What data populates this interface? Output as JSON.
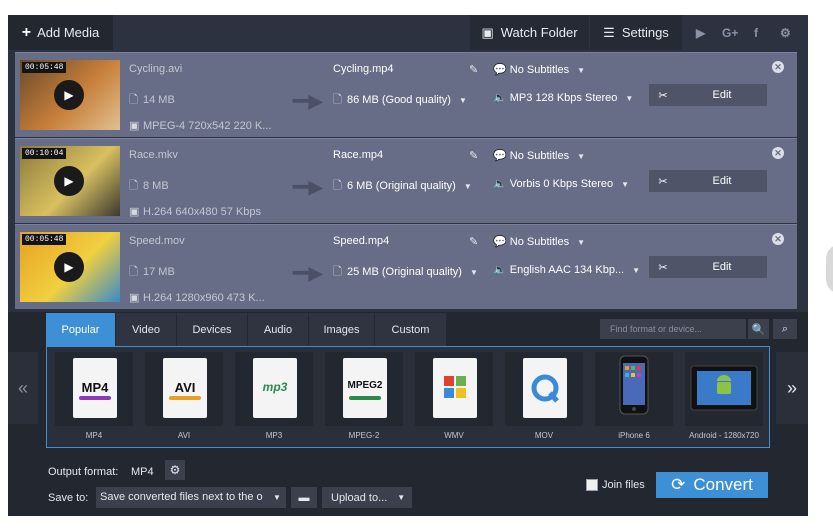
{
  "topbar": {
    "add_media": "Add Media",
    "watch_folder": "Watch Folder",
    "settings": "Settings",
    "social": [
      "▶",
      "G+",
      "f",
      "⚙"
    ]
  },
  "files": [
    {
      "duration": "00:05:48",
      "source_name": "Cycling.avi",
      "source_size": "14 MB",
      "source_info": "MPEG-4 720x542 220 K...",
      "output_name": "Cycling.mp4",
      "output_size": "86 MB (Good quality)",
      "subtitles": "No Subtitles",
      "audio": "MP3 128 Kbps Stereo",
      "edit": "Edit",
      "thumb_colors": [
        "#6a4a2a",
        "#c87f3a",
        "#e0c090"
      ]
    },
    {
      "duration": "00:10:04",
      "source_name": "Race.mkv",
      "source_size": "8 MB",
      "source_info": "H.264 640x480 57 Kbps",
      "output_name": "Race.mp4",
      "output_size": "6 MB (Original quality)",
      "subtitles": "No Subtitles",
      "audio": "Vorbis 0 Kbps Stereo",
      "edit": "Edit",
      "thumb_colors": [
        "#8a7a3a",
        "#d8c060",
        "#3a3a30"
      ]
    },
    {
      "duration": "00:05:48",
      "source_name": "Speed.mov",
      "source_size": "17 MB",
      "source_info": "H.264 1280x960 473 K...",
      "output_name": "Speed.mp4",
      "output_size": "25 MB (Original quality)",
      "subtitles": "No Subtitles",
      "audio": "English AAC 134 Kbp...",
      "edit": "Edit",
      "thumb_colors": [
        "#e8a020",
        "#f0d040",
        "#3a8ac8"
      ]
    }
  ],
  "format_tabs": [
    "Popular",
    "Video",
    "Devices",
    "Audio",
    "Images",
    "Custom"
  ],
  "active_tab": "Popular",
  "search": {
    "placeholder": "Find format or device..."
  },
  "formats": [
    {
      "label": "MP4",
      "logo": "MP4",
      "color": "#8a3ab8"
    },
    {
      "label": "AVI",
      "logo": "AVI",
      "color": "#e8a020"
    },
    {
      "label": "MP3",
      "logo": "mp3",
      "color": "#2a8a4a"
    },
    {
      "label": "MPEG-2",
      "logo": "MPEG2",
      "color": "#2a8a4a"
    },
    {
      "label": "WMV",
      "logo": "wmv-logo",
      "color": "#e04030"
    },
    {
      "label": "MOV",
      "logo": "quicktime-logo",
      "color": "#3a8ad8"
    },
    {
      "label": "iPhone 6",
      "logo": "iphone-icon",
      "color": "#222222"
    },
    {
      "label": "Android - 1280x720",
      "logo": "android-icon",
      "color": "#8bc34a"
    }
  ],
  "bottom": {
    "output_format_label": "Output format:",
    "output_format_value": "MP4",
    "save_to_label": "Save to:",
    "save_to_value": "Save converted files next to the o",
    "upload_label": "Upload to...",
    "join_files": "Join files",
    "convert": "Convert"
  },
  "colors": {
    "accent": "#3d8fd6",
    "row_bg": "#676d86",
    "app_bg": "#2d3240"
  }
}
